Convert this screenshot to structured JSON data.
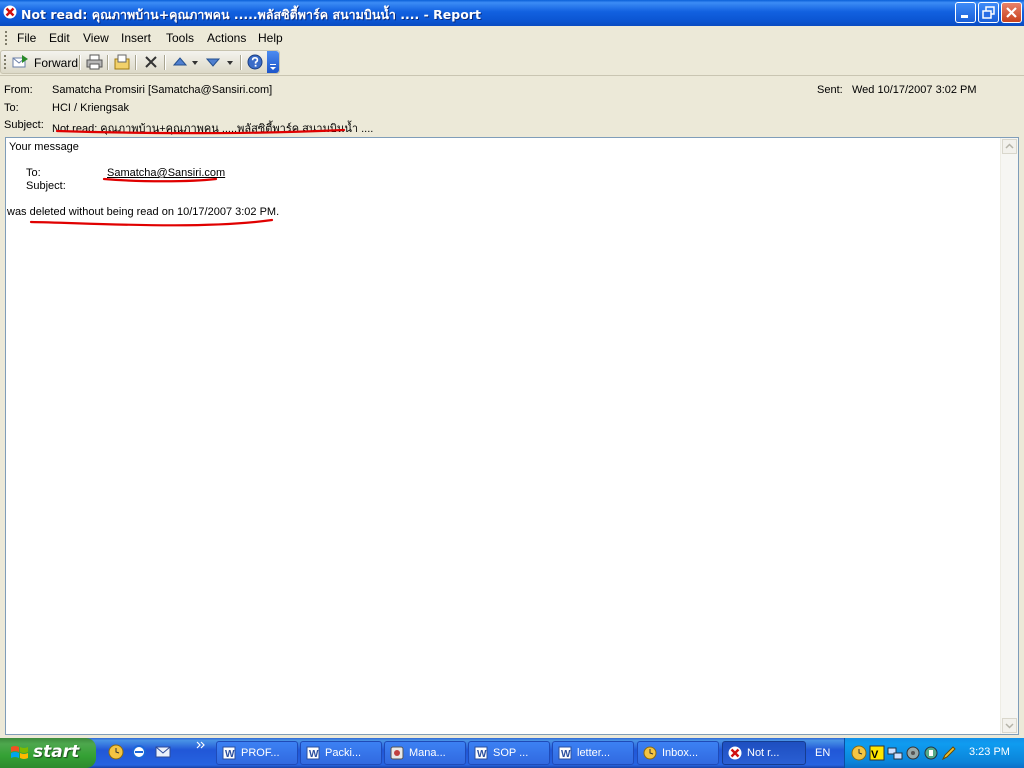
{
  "window": {
    "title": "Not read: คุณภาพบ้าน+คุณภาพคน .....พลัสซิตี้พาร์ค สนามบินน้ำ .... - Report"
  },
  "menu": [
    "File",
    "Edit",
    "View",
    "Insert",
    "Tools",
    "Actions",
    "Help"
  ],
  "toolbar": {
    "forward_label": "Forward",
    "icons": [
      "forward-icon",
      "print-icon",
      "move-to-folder-icon",
      "delete-icon",
      "previous-item-icon",
      "next-item-icon",
      "help-icon"
    ]
  },
  "header": {
    "from_label": "From:",
    "from_value": "Samatcha Promsiri [Samatcha@Sansiri.com]",
    "to_label": "To:",
    "to_value": "HCI / Kriengsak",
    "subject_label": "Subject:",
    "subject_value": "Not read: คุณภาพบ้าน+คุณภาพคน .....พลัสซิตี้พาร์ค สนามบินน้ำ ....",
    "sent_label": "Sent:",
    "sent_value": "Wed 10/17/2007 3:02 PM"
  },
  "body": {
    "line1": "Your message",
    "to_label": "To:",
    "to_value": "Samatcha@Sansiri.com",
    "subject_label": "Subject:",
    "status_line": "was deleted without being read on 10/17/2007 3:02 PM."
  },
  "annotation_color": "#e00000",
  "taskbar": {
    "start_label": "start",
    "tasks": [
      {
        "label": "PROF...",
        "icon": "word-doc-icon"
      },
      {
        "label": "Packi...",
        "icon": "word-doc-icon"
      },
      {
        "label": "Mana...",
        "icon": "app-icon"
      },
      {
        "label": "SOP ...",
        "icon": "word-doc-icon"
      },
      {
        "label": "letter...",
        "icon": "word-doc-icon"
      },
      {
        "label": "Inbox...",
        "icon": "outlook-icon"
      },
      {
        "label": "Not r...",
        "icon": "report-icon"
      }
    ],
    "language": "EN",
    "clock": "3:23 PM"
  }
}
